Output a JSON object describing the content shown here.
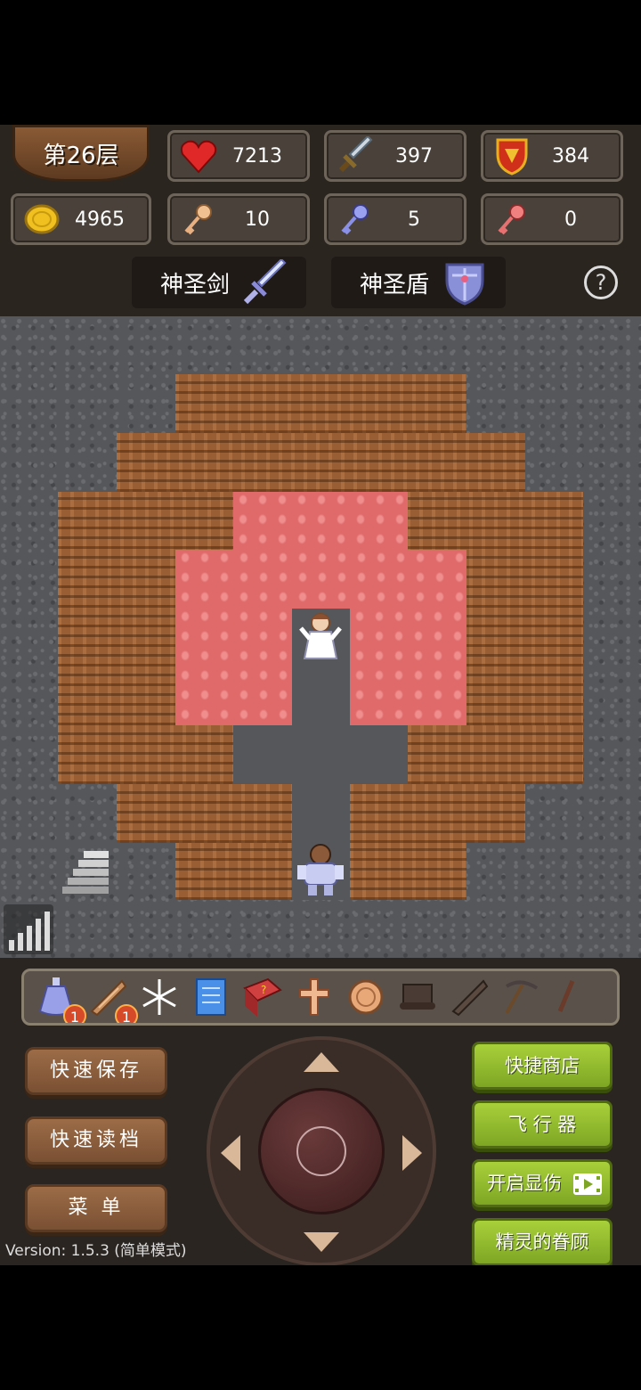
{
  "floor": {
    "label": "第26层"
  },
  "stats": {
    "hp": "7213",
    "attack": "397",
    "defense": "384",
    "gold": "4965",
    "yellow_keys": "10",
    "blue_keys": "5",
    "red_keys": "0"
  },
  "equipment": {
    "weapon": "神圣剑",
    "shield": "神圣盾"
  },
  "help_label": "?",
  "toolbar": {
    "badges": [
      "1",
      "1"
    ]
  },
  "buttons": {
    "quick_save": "快速保存",
    "quick_load": "快速读档",
    "menu": "菜  单",
    "quick_shop": "快捷商店",
    "flyer": "飞 行 器",
    "show_damage": "开启显伤",
    "fairy_favor": "精灵的眷顾"
  },
  "version": "Version: 1.5.3 (简单模式)",
  "colors": {
    "lava": "#e06a6a",
    "dirt": "#9a5e34",
    "stone": "#56575a",
    "green_button": "#9bc432",
    "brown_button": "#8a5c3a"
  }
}
